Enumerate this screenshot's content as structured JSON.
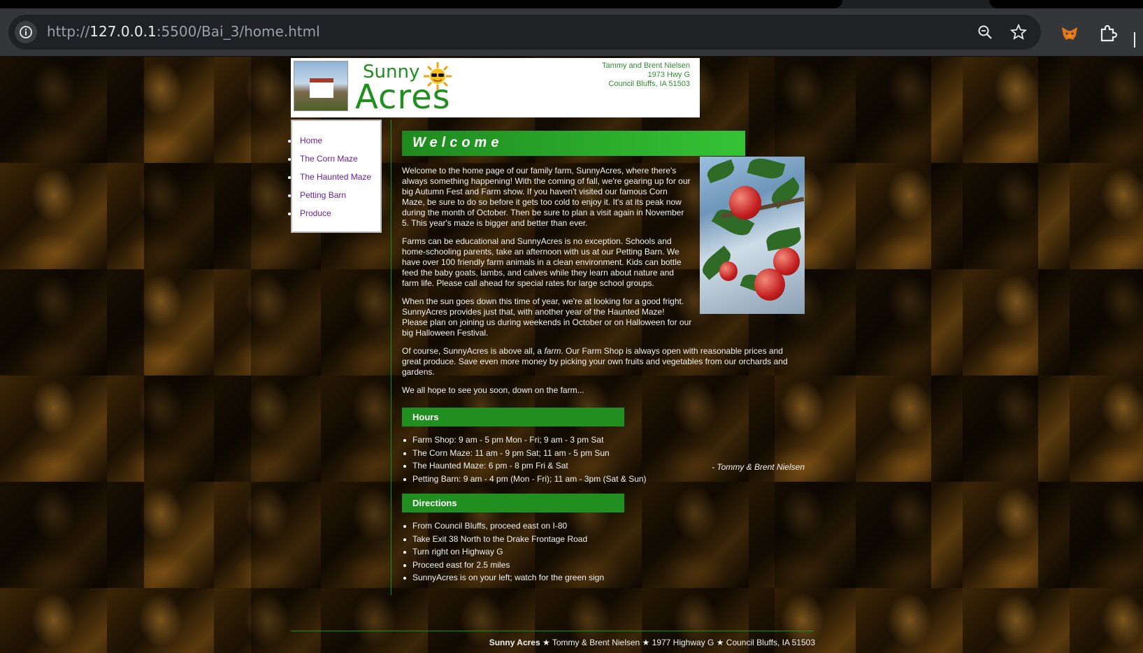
{
  "browser": {
    "url_prefix": "http://",
    "url_host": "127.0.0.1",
    "url_rest": ":5500/Bai_3/home.html"
  },
  "header": {
    "logo_top": "Sunny",
    "logo_bottom": "Acres",
    "address": [
      "Tammy and Brent Nielsen",
      "1973 Hwy G",
      "Council Bluffs, IA  51503"
    ]
  },
  "nav": {
    "items": [
      "Home",
      "The Corn Maze",
      "The Haunted Maze",
      "Petting Barn",
      "Produce"
    ],
    "link_color": "#6b1d9a"
  },
  "welcome": {
    "title": "Welcome",
    "p1": "Welcome to the home page of our family farm, SunnyAcres, where there's always something happening! With the coming of fall, we're gearing up for our big Autumn Fest and Farm show. If you haven't visited our famous Corn Maze, be sure to do so before it gets too cold to enjoy it. It's at its peak now during the month of October. Then be sure to plan a visit again in November 5. This year's maze is bigger and better than ever.",
    "p2": "Farms can be educational and SunnyAcres is no exception. Schools and home-schooling parents, take an afternoon with us at our Petting Barn. We have over 100 friendly farm animals in a clean environment. Kids can bottle feed the baby goats, lambs, and calves while they learn about nature and farm life. Please call ahead for special rates for large school groups.",
    "p3": "When the sun goes down this time of year, we're at looking for a good fright. SunnyAcres provides just that, with another year of the Haunted Maze! Please plan on joining us during weekends in October or on Halloween for our big Halloween Festival.",
    "p4_a": "Of course, SunnyAcres is above all, a ",
    "p4_em": "farm",
    "p4_b": ". Our Farm Shop is always open with reasonable prices and great produce. Save even more money by picking your own fruits and vegetables from our orchards and gardens.",
    "p5": "We all hope to see you soon, down on the farm...",
    "signature": "- Tommy & Brent Nielsen"
  },
  "hours": {
    "title": "Hours",
    "items": [
      "Farm Shop: 9 am - 5 pm Mon - Fri; 9 am - 3 pm Sat",
      "The Corn Maze: 11 am - 9 pm Sat; 11 am - 5 pm Sun",
      "The Haunted Maze: 6 pm - 8 pm Fri & Sat",
      "Petting Barn: 9 am - 4 pm (Mon - Fri); 11 am - 3pm (Sat & Sun)"
    ]
  },
  "directions": {
    "title": "Directions",
    "items": [
      "From Council Bluffs, proceed east on I-80",
      "Take Exit 38 North to the Drake Frontage Road",
      "Turn right on Highway G",
      "Proceed east for 2.5 miles",
      "SunnyAcres is on your left; watch for the green sign"
    ]
  },
  "footer": {
    "brand": "Sunny Acres",
    "rest": " ★ Tommy & Brent Nielsen ★ 1977 Highway G ★ Council Bluffs, IA 51503"
  },
  "colors": {
    "accent_green": "#208f20",
    "page_bg": "#120b02"
  }
}
